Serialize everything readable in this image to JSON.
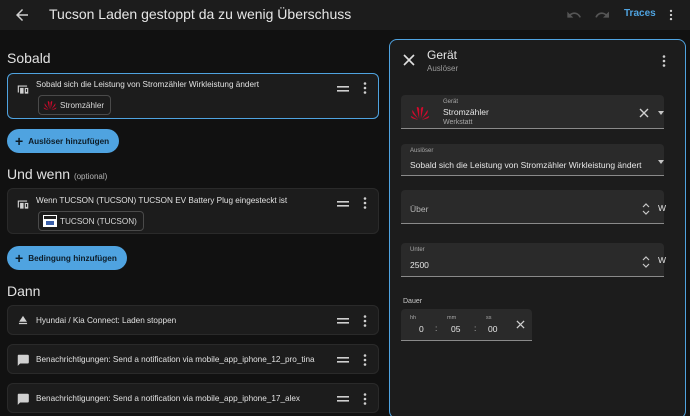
{
  "header": {
    "title": "Tucson Laden gestoppt da zu wenig Überschuss",
    "traces_label": "Traces",
    "icons": [
      "arrow-left-icon",
      "undo-icon",
      "redo-icon",
      "more-vertical-icon"
    ]
  },
  "triggers": {
    "title": "Sobald",
    "items": [
      {
        "text": "Sobald sich die Leistung von Stromzähler Wirkleistung ändert",
        "chip": "Stromzähler",
        "icon": "device-icon"
      }
    ],
    "add_label": "Auslöser hinzufügen"
  },
  "conditions": {
    "title": "Und wenn",
    "optional": "(optional)",
    "items": [
      {
        "text": "Wenn TUCSON (TUCSON) TUCSON EV Battery Plug eingesteckt ist",
        "chip": "TUCSON (TUCSON)",
        "icon": "device-icon"
      }
    ],
    "add_label": "Bedingung hinzufügen"
  },
  "actions": {
    "title": "Dann",
    "items": [
      {
        "text": "Hyundai / Kia Connect: Laden stoppen",
        "icon": "eject-icon"
      },
      {
        "text": "Benachrichtigungen: Send a notification via mobile_app_iphone_12_pro_tina",
        "icon": "message-icon"
      },
      {
        "text": "Benachrichtigungen: Send a notification via mobile_app_iphone_17_alex",
        "icon": "message-icon"
      }
    ]
  },
  "panel": {
    "title": "Gerät",
    "subtitle": "Auslöser",
    "device": {
      "label": "Gerät",
      "value": "Stromzähler",
      "secondary": "Werkstatt"
    },
    "trigger": {
      "label": "Auslöser",
      "value": "Sobald sich die Leistung von Stromzähler Wirkleistung ändert"
    },
    "above": {
      "placeholder": "Über",
      "unit": "W"
    },
    "below": {
      "label": "Unter",
      "value": "2500",
      "unit": "W"
    },
    "duration": {
      "label": "Dauer",
      "hh_label": "hh",
      "hh": "0",
      "mm_label": "mm",
      "mm": "05",
      "ss_label": "ss",
      "ss": "00"
    }
  },
  "colors": {
    "accent": "#4fa3e0",
    "background": "#111111",
    "card": "#1c1c1c",
    "huawei_red": "#cf0a2c"
  }
}
